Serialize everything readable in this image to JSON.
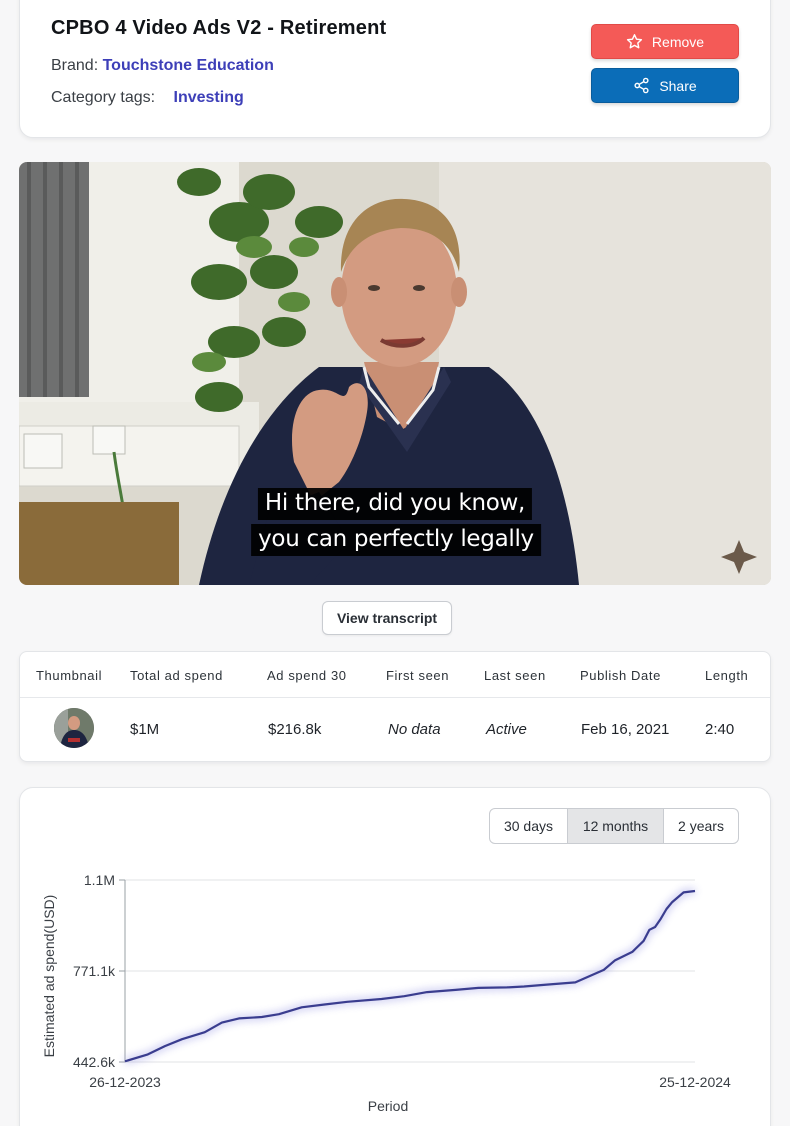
{
  "header": {
    "title": "CPBO 4 Video Ads V2 - Retirement",
    "brand_label": "Brand:",
    "brand_name": "Touchstone Education",
    "tags_label": "Category tags:",
    "tags": [
      "Investing"
    ],
    "remove_label": "Remove",
    "share_label": "Share",
    "remove_color": "#f45a57",
    "share_color": "#0b6db8"
  },
  "video": {
    "subtitle_line1": "Hi there, did you know,",
    "subtitle_line2": "you can perfectly legally"
  },
  "transcript_button": "View transcript",
  "table": {
    "headers": [
      "Thumbnail",
      "Total ad spend",
      "Ad spend 30",
      "First seen",
      "Last seen",
      "Publish Date",
      "Length"
    ],
    "row": {
      "total_ad_spend": "$1M",
      "ad_spend_30": "$216.8k",
      "first_seen": "No data",
      "last_seen": "Active",
      "publish_date": "Feb 16, 2021",
      "length": "2:40"
    }
  },
  "period_options": [
    "30 days",
    "12 months",
    "2 years"
  ],
  "selected_period": "12 months",
  "chart_data": {
    "type": "line",
    "title": "",
    "xlabel": "Period",
    "ylabel": "Estimated ad spend(USD)",
    "x_tick_labels": [
      "26-12-2023",
      "25-12-2024"
    ],
    "y_tick_labels": [
      "442.6k",
      "771.1k",
      "1.1M"
    ],
    "ylim": [
      442.6,
      1099.6
    ],
    "y_unit": "thousands USD",
    "line_color": "#3a3d8f",
    "x_fraction_of_year": [
      0,
      0.04,
      0.07,
      0.1,
      0.14,
      0.17,
      0.2,
      0.24,
      0.27,
      0.31,
      0.35,
      0.39,
      0.45,
      0.49,
      0.53,
      0.58,
      0.62,
      0.67,
      0.7,
      0.74,
      0.79,
      0.84,
      0.86,
      0.89,
      0.91,
      0.92,
      0.93,
      0.94,
      0.95,
      0.96,
      0.98,
      1.0
    ],
    "values": [
      445,
      470,
      500,
      525,
      550,
      585,
      600,
      605,
      615,
      640,
      650,
      660,
      670,
      680,
      695,
      703,
      710,
      712,
      715,
      722,
      730,
      775,
      810,
      840,
      880,
      920,
      930,
      960,
      995,
      1020,
      1055,
      1060
    ]
  }
}
